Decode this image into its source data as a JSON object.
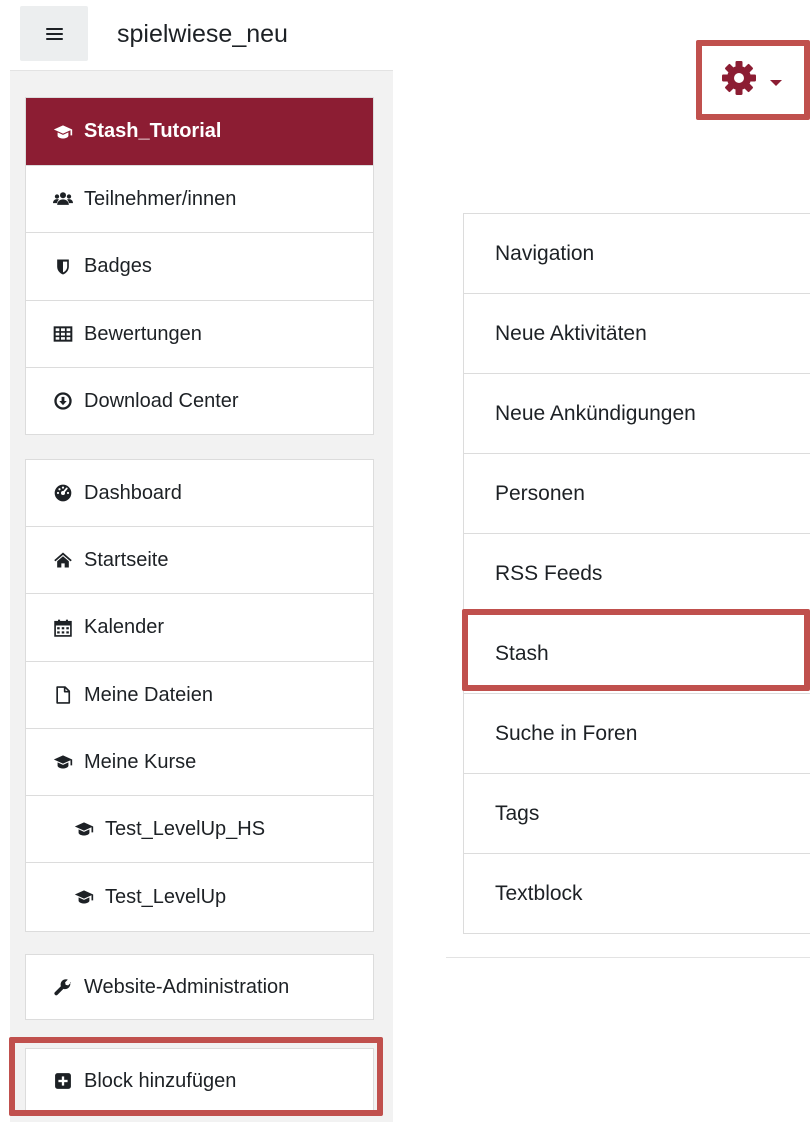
{
  "header": {
    "menu_button_icon": "hamburger-icon",
    "site_name": "spielwiese_neu"
  },
  "drawer": {
    "course_group": [
      {
        "label": "Stash_Tutorial",
        "icon": "graduation-cap-icon",
        "active": true
      },
      {
        "label": "Teilnehmer/innen",
        "icon": "users-icon"
      },
      {
        "label": "Badges",
        "icon": "shield-icon"
      },
      {
        "label": "Bewertungen",
        "icon": "table-icon"
      },
      {
        "label": "Download Center",
        "icon": "download-circle-icon"
      }
    ],
    "site_group": [
      {
        "label": "Dashboard",
        "icon": "tachometer-icon"
      },
      {
        "label": "Startseite",
        "icon": "home-icon"
      },
      {
        "label": "Kalender",
        "icon": "calendar-icon"
      },
      {
        "label": "Meine Dateien",
        "icon": "file-icon"
      },
      {
        "label": "Meine Kurse",
        "icon": "graduation-cap-icon"
      },
      {
        "label": "Test_LevelUp_HS",
        "icon": "graduation-cap-icon"
      },
      {
        "label": "Test_LevelUp",
        "icon": "graduation-cap-icon"
      }
    ],
    "admin_group": [
      {
        "label": "Website-Administration",
        "icon": "wrench-icon"
      }
    ],
    "add_block_group": [
      {
        "label": "Block hinzufügen",
        "icon": "plus-square-icon"
      }
    ]
  },
  "actions_menu": {
    "icon": "gear-icon",
    "caret": "caret-down-icon"
  },
  "block_list": {
    "items": [
      "Navigation",
      "Neue Aktivitäten",
      "Neue Ankündigungen",
      "Personen",
      "RSS Feeds",
      "Stash",
      "Suche in Foren",
      "Tags",
      "Textblock"
    ]
  },
  "colors": {
    "brand": "#8c1d33",
    "highlight": "#c0504d",
    "drawer_bg": "#f2f2f2",
    "border": "#dcdcdc"
  }
}
